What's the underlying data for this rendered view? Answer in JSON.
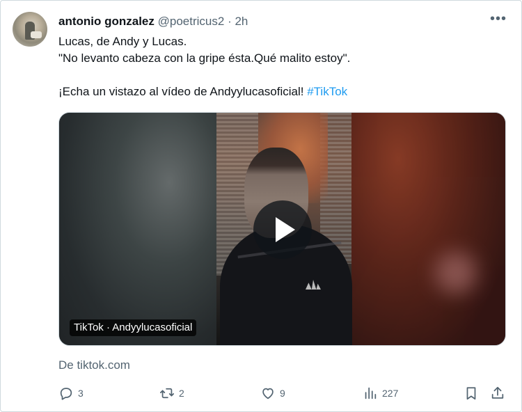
{
  "tweet": {
    "author_name": "antonio gonzalez",
    "author_handle": "@poetricus2",
    "separator": "·",
    "time": "2h",
    "more_label": "•••",
    "lines": [
      "Lucas, de Andy y Lucas.",
      "\"No levanto cabeza con la gripe ésta.Qué malito estoy\"."
    ],
    "cta_text": "¡Echa un vistazo al vídeo de Andyylucasoficial! ",
    "hashtag": "#TikTok",
    "media_label": "TikTok · Andyylucasoficial",
    "source": "De tiktok.com"
  },
  "actions": {
    "replies": "3",
    "retweets": "2",
    "likes": "9",
    "views": "227"
  },
  "icons": {
    "more": "more-dots-icon",
    "reply": "reply-bubble-icon",
    "retweet": "retweet-icon",
    "like": "heart-icon",
    "views": "views-chart-icon",
    "bookmark": "bookmark-icon",
    "share": "share-upload-icon",
    "play": "play-icon"
  },
  "colors": {
    "text": "#0f1419",
    "secondary": "#536471",
    "link": "#1d9bf0",
    "border": "#cfd9de"
  }
}
